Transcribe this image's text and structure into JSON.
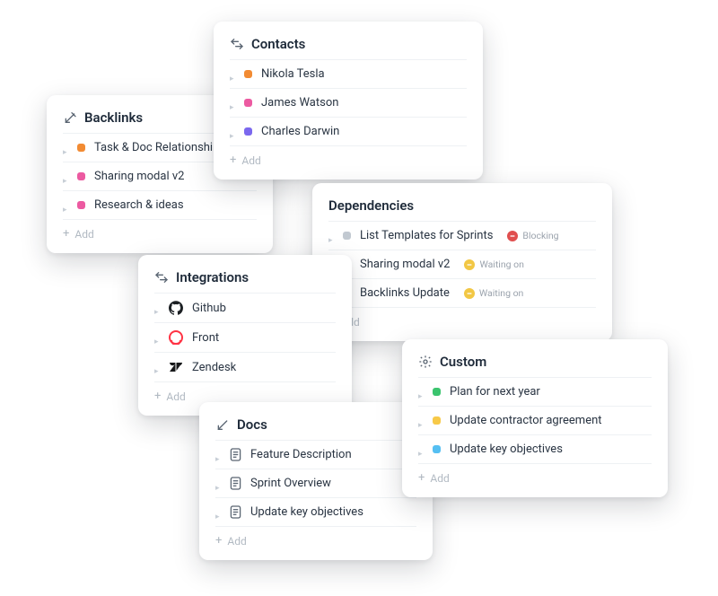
{
  "add_label": "Add",
  "colors": {
    "orange": "#f28b33",
    "pink": "#ec5aa1",
    "purple": "#7b68ee",
    "gray": "#c2c9d1",
    "green": "#3bc46e",
    "yellow": "#f7c948",
    "sky": "#55bff2",
    "red": "#e04f4f",
    "amber": "#f2c744"
  },
  "cards": {
    "contacts": {
      "title": "Contacts",
      "items": [
        {
          "label": "Nikola Tesla",
          "color": "orange"
        },
        {
          "label": "James Watson",
          "color": "pink"
        },
        {
          "label": "Charles Darwin",
          "color": "purple"
        }
      ]
    },
    "backlinks": {
      "title": "Backlinks",
      "items": [
        {
          "label": "Task & Doc Relationships",
          "color": "orange"
        },
        {
          "label": "Sharing modal v2",
          "color": "pink"
        },
        {
          "label": "Research & ideas",
          "color": "pink"
        }
      ]
    },
    "dependencies": {
      "title": "Dependencies",
      "items": [
        {
          "label": "List Templates for Sprints",
          "color": "gray",
          "status": {
            "label": "Blocking",
            "kind": "blocking"
          }
        },
        {
          "label": "Sharing modal v2",
          "color": "pink",
          "status": {
            "label": "Waiting on",
            "kind": "waiting"
          }
        },
        {
          "label": "Backlinks Update",
          "color": "purple",
          "status": {
            "label": "Waiting on",
            "kind": "waiting"
          }
        }
      ]
    },
    "integrations": {
      "title": "Integrations",
      "items": [
        {
          "label": "Github",
          "brand": "github"
        },
        {
          "label": "Front",
          "brand": "front"
        },
        {
          "label": "Zendesk",
          "brand": "zendesk"
        }
      ]
    },
    "custom": {
      "title": "Custom",
      "items": [
        {
          "label": "Plan for next year",
          "color": "green"
        },
        {
          "label": "Update contractor agreement",
          "color": "yellow"
        },
        {
          "label": "Update key objectives",
          "color": "sky"
        }
      ]
    },
    "docs": {
      "title": "Docs",
      "items": [
        {
          "label": "Feature Description"
        },
        {
          "label": "Sprint Overview"
        },
        {
          "label": "Update key objectives"
        }
      ]
    }
  }
}
